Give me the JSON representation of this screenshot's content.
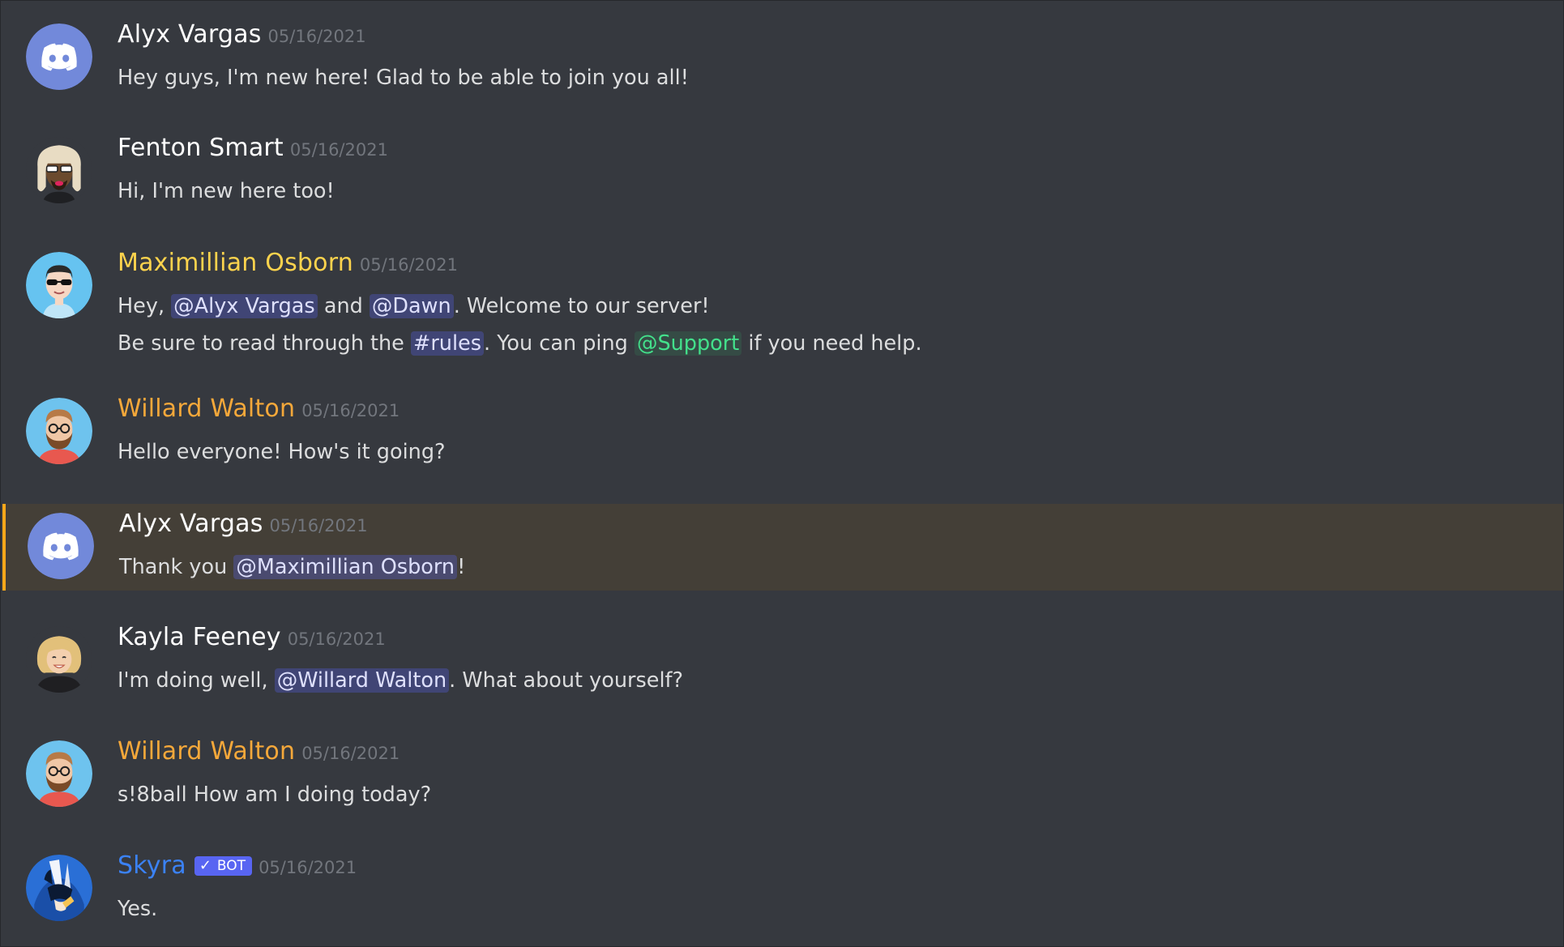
{
  "colors": {
    "background": "#36393f",
    "highlight_background": "#443f37",
    "highlight_bar": "#faa81a",
    "mention_bg": "#4a4f7b",
    "role_mention_color": "#43e08b",
    "timestamp": "#72767d",
    "bot_tag": "#5865f2"
  },
  "messages": [
    {
      "author": "Alyx Vargas",
      "author_color": "#ffffff",
      "avatar_icon": "discord-logo-avatar",
      "timestamp": "05/16/2021",
      "lines": [
        [
          {
            "t": "text",
            "v": "Hey guys, I'm new here! Glad to be able to join you all!"
          }
        ]
      ]
    },
    {
      "author": "Fenton Smart",
      "author_color": "#ffffff",
      "avatar_icon": "person-sunglasses-avatar",
      "timestamp": "05/16/2021",
      "lines": [
        [
          {
            "t": "text",
            "v": "Hi, I'm new here too!"
          }
        ]
      ]
    },
    {
      "author": "Maximillian Osborn",
      "author_color": "#fcd34d",
      "avatar_icon": "person-sunglasses-blue-avatar",
      "timestamp": "05/16/2021",
      "lines": [
        [
          {
            "t": "text",
            "v": "Hey, "
          },
          {
            "t": "mention",
            "v": "@Alyx Vargas"
          },
          {
            "t": "text",
            "v": " and "
          },
          {
            "t": "mention",
            "v": "@Dawn"
          },
          {
            "t": "text",
            "v": ". Welcome to our server!"
          }
        ],
        [
          {
            "t": "text",
            "v": "Be sure to read through the "
          },
          {
            "t": "mention",
            "v": "#rules"
          },
          {
            "t": "text",
            "v": ". You can ping "
          },
          {
            "t": "role",
            "v": "@Support"
          },
          {
            "t": "text",
            "v": " if you need help."
          }
        ]
      ]
    },
    {
      "author": "Willard Walton",
      "author_color": "#f5a83a",
      "avatar_icon": "bearded-man-avatar",
      "timestamp": "05/16/2021",
      "lines": [
        [
          {
            "t": "text",
            "v": "Hello everyone! How's it going?"
          }
        ]
      ]
    },
    {
      "author": "Alyx Vargas",
      "author_color": "#ffffff",
      "avatar_icon": "discord-logo-avatar",
      "timestamp": "05/16/2021",
      "highlighted": true,
      "lines": [
        [
          {
            "t": "text",
            "v": "Thank you "
          },
          {
            "t": "mention",
            "v": "@Maximillian Osborn"
          },
          {
            "t": "text",
            "v": "!"
          }
        ]
      ]
    },
    {
      "author": "Kayla Feeney",
      "author_color": "#ffffff",
      "avatar_icon": "blonde-woman-avatar",
      "timestamp": "05/16/2021",
      "lines": [
        [
          {
            "t": "text",
            "v": "I'm doing well, "
          },
          {
            "t": "mention",
            "v": "@Willard Walton"
          },
          {
            "t": "text",
            "v": ". What about yourself?"
          }
        ]
      ]
    },
    {
      "author": "Willard Walton",
      "author_color": "#f5a83a",
      "avatar_icon": "bearded-man-avatar",
      "timestamp": "05/16/2021",
      "lines": [
        [
          {
            "t": "text",
            "v": "s!8ball How am I doing today?"
          }
        ]
      ]
    },
    {
      "author": "Skyra",
      "author_color": "#3b82f6",
      "avatar_icon": "anime-character-avatar",
      "timestamp": "05/16/2021",
      "bot_tag": "BOT",
      "bot_check": "✓",
      "lines": [
        [
          {
            "t": "text",
            "v": "Yes."
          }
        ]
      ]
    }
  ]
}
